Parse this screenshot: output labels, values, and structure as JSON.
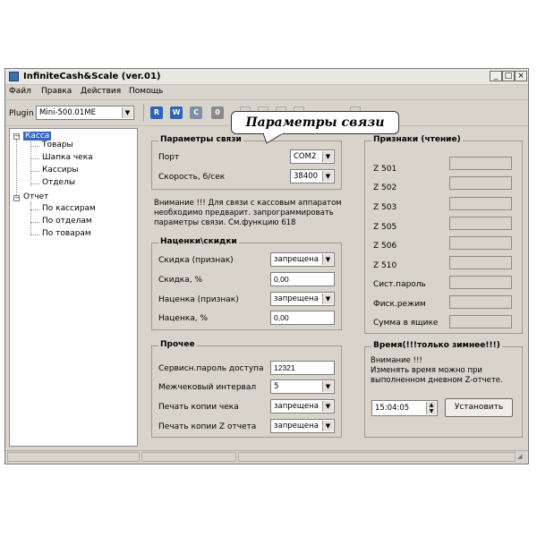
{
  "window": {
    "title": "InfiniteCash&Scale (ver.01)",
    "min": "_",
    "max": "□",
    "close": "×"
  },
  "menu": [
    "Файл",
    "Правка",
    "Действия",
    "Помощь"
  ],
  "toolbar": {
    "plugin_label": "Plugin",
    "plugin_value": "Mini-500.01ME",
    "buttons": [
      {
        "label": "R",
        "color": "#2d63b8"
      },
      {
        "label": "W",
        "color": "#2d63b8"
      },
      {
        "label": "C",
        "color": "#7e8fa6"
      },
      {
        "label": "0",
        "color": "#8a8a8a"
      }
    ]
  },
  "callout": "Параметры связи",
  "tree": {
    "root1": "Касса",
    "root1_children": [
      "Товары",
      "Шапка чека",
      "Кассиры",
      "Отделы"
    ],
    "root2": "Отчет",
    "root2_children": [
      "По кассирам",
      "По отделам",
      "По товарам"
    ]
  },
  "conn": {
    "title": "Параметры связи",
    "port_label": "Порт",
    "port_value": "COM2",
    "speed_label": "Скорость, б/сек",
    "speed_value": "38400",
    "note_lines": [
      "Внимание !!! Для связи с кассовым аппаратом",
      "необходимо  предварит. запрограммировать",
      "параметры связи. См.функцию 618"
    ]
  },
  "markups": {
    "title": "Наценки\\скидки",
    "rows": [
      {
        "label": "Скидка (признак)",
        "value": "запрещена",
        "type": "select"
      },
      {
        "label": "Скидка, %",
        "value": "0,00",
        "type": "input"
      },
      {
        "label": "Наценка (признак)",
        "value": "запрещена",
        "type": "select"
      },
      {
        "label": "Наценка, %",
        "value": "0,00",
        "type": "input"
      }
    ]
  },
  "other": {
    "title": "Прочее",
    "rows": [
      {
        "label": "Сервисн.пароль доступа",
        "value": "12321",
        "type": "input"
      },
      {
        "label": "Межчековый интервал",
        "value": "5",
        "type": "select"
      },
      {
        "label": "Печать копии чека",
        "value": "запрещена",
        "type": "select"
      },
      {
        "label": "Печать копии Z отчета",
        "value": "запрещена",
        "type": "select"
      }
    ]
  },
  "flags": {
    "title": "Признаки (чтение)",
    "labels": [
      "Z 501",
      "Z 502",
      "Z 503",
      "Z 505",
      "Z 506",
      "Z 510",
      "Сист.пароль",
      "Фиск.режим",
      "Сумма в ящике"
    ]
  },
  "time": {
    "title": "Время(!!!только зимнее!!!)",
    "note_lines": [
      "Внимание !!!",
      "Изменять время можно при",
      "выполненном дневном Z-отчете."
    ],
    "value": "15:04:05",
    "set_button": "Установить"
  }
}
